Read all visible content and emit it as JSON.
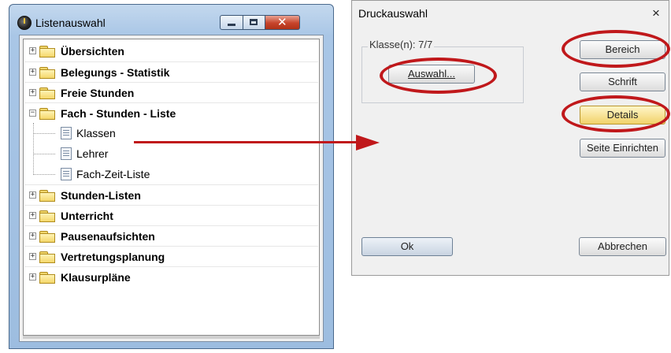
{
  "left_window": {
    "title": "Listenauswahl",
    "tree": {
      "groups_top": [
        {
          "label": "Übersichten",
          "expander": "+"
        },
        {
          "label": "Belegungs - Statistik",
          "expander": "+"
        },
        {
          "label": "Freie Stunden",
          "expander": "+"
        },
        {
          "label": "Fach - Stunden - Liste",
          "expander": "−"
        }
      ],
      "children": [
        {
          "label": "Klassen"
        },
        {
          "label": "Lehrer"
        },
        {
          "label": "Fach-Zeit-Liste"
        }
      ],
      "groups_bottom": [
        {
          "label": "Stunden-Listen",
          "expander": "+"
        },
        {
          "label": "Unterricht",
          "expander": "+"
        },
        {
          "label": "Pausenaufsichten",
          "expander": "+"
        },
        {
          "label": "Vertretungsplanung",
          "expander": "+"
        },
        {
          "label": "Klausurpläne",
          "expander": "+"
        }
      ]
    }
  },
  "dialog": {
    "title": "Druckauswahl",
    "close_symbol": "×",
    "group_label": "Klasse(n): 7/7",
    "auswahl_button": "Auswahl...",
    "bereich_button": "Bereich",
    "schrift_button": "Schrift",
    "details_button": "Details",
    "seite_button": "Seite Einrichten",
    "ok_button": "Ok",
    "cancel_button": "Abbrechen"
  },
  "colors": {
    "highlight_ring": "#c0181b",
    "details_button_bg": "#f1d26a",
    "title_bar": "#a9c6e6",
    "close_button": "#c6442b"
  },
  "icons": {
    "app_icon": "clock-icon",
    "folder_icon": "folder-icon",
    "doc_icon": "list-document-icon"
  }
}
